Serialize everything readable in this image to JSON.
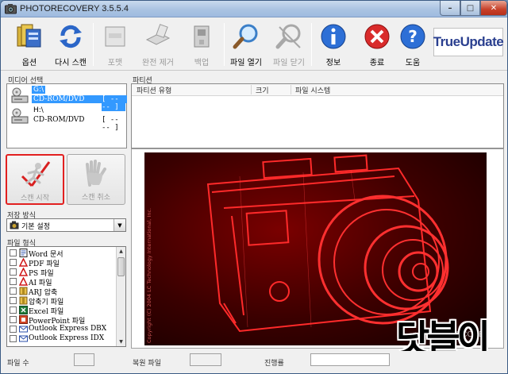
{
  "window": {
    "title": "PHOTORECOVERY 3.5.5.4",
    "controls": {
      "minimize": "–",
      "maximize": "□",
      "close": "✕"
    }
  },
  "toolbar": {
    "buttons": [
      {
        "label": "옵션",
        "icon": "options-folder-icon",
        "enabled": true
      },
      {
        "label": "다시 스캔",
        "icon": "rescan-icon",
        "enabled": true
      },
      {
        "label": "포맷",
        "icon": "format-icon",
        "enabled": false
      },
      {
        "label": "완전 제거",
        "icon": "wipe-icon",
        "enabled": false
      },
      {
        "label": "백업",
        "icon": "backup-icon",
        "enabled": false
      },
      {
        "label": "파일 열기",
        "icon": "magnifier-icon",
        "enabled": true
      },
      {
        "label": "파일 닫기",
        "icon": "close-file-icon",
        "enabled": false
      },
      {
        "label": "정보",
        "icon": "info-icon",
        "enabled": true
      },
      {
        "label": "종료",
        "icon": "exit-icon",
        "enabled": true
      },
      {
        "label": "도움",
        "icon": "help-icon",
        "enabled": true
      }
    ],
    "logo": "TrueUpdate"
  },
  "devices": {
    "title": "미디어 선택",
    "items": [
      {
        "name": "G:\\",
        "type": "CD-ROM/DVD",
        "size": "[ -- -- ]",
        "selected": true
      },
      {
        "name": "H:\\",
        "type": "CD-ROM/DVD",
        "size": "[ -- -- ]",
        "selected": false
      }
    ]
  },
  "partitions": {
    "title": "파티션",
    "columns": [
      "파티션 유형",
      "크기",
      "파일 시스템"
    ]
  },
  "scan": {
    "start_label": "스캔 시작",
    "stop_label": "스캔 취소"
  },
  "scan_mode": {
    "title": "저장 방식",
    "value": "기본 설정"
  },
  "file_types": {
    "title": "파일 형식",
    "items": [
      {
        "label": "Word 문서",
        "icon": "word-doc-icon"
      },
      {
        "label": "PDF 파일",
        "icon": "pdf-icon"
      },
      {
        "label": "PS 파일",
        "icon": "ps-icon"
      },
      {
        "label": "AI 파일",
        "icon": "ai-icon"
      },
      {
        "label": "ARJ 압축",
        "icon": "arj-icon"
      },
      {
        "label": "압축기 파일",
        "icon": "archive-icon"
      },
      {
        "label": "Excel 파일",
        "icon": "excel-icon"
      },
      {
        "label": "PowerPoint 파일",
        "icon": "powerpoint-icon"
      },
      {
        "label": "Outlook Express DBX",
        "icon": "outlook-dbx-icon"
      },
      {
        "label": "Outlook Express IDX",
        "icon": "outlook-idx-icon"
      }
    ]
  },
  "preview": {
    "copyright": "Copyright (C) 2004 LC Technology International, Inc.",
    "brand": "PHOTORECOVERY"
  },
  "watermark": "닷블이",
  "status": {
    "files_label": "파일 수",
    "files_value": "",
    "recovered_label": "복원 파일",
    "recovered_value": "",
    "progress_label": "진행률"
  }
}
